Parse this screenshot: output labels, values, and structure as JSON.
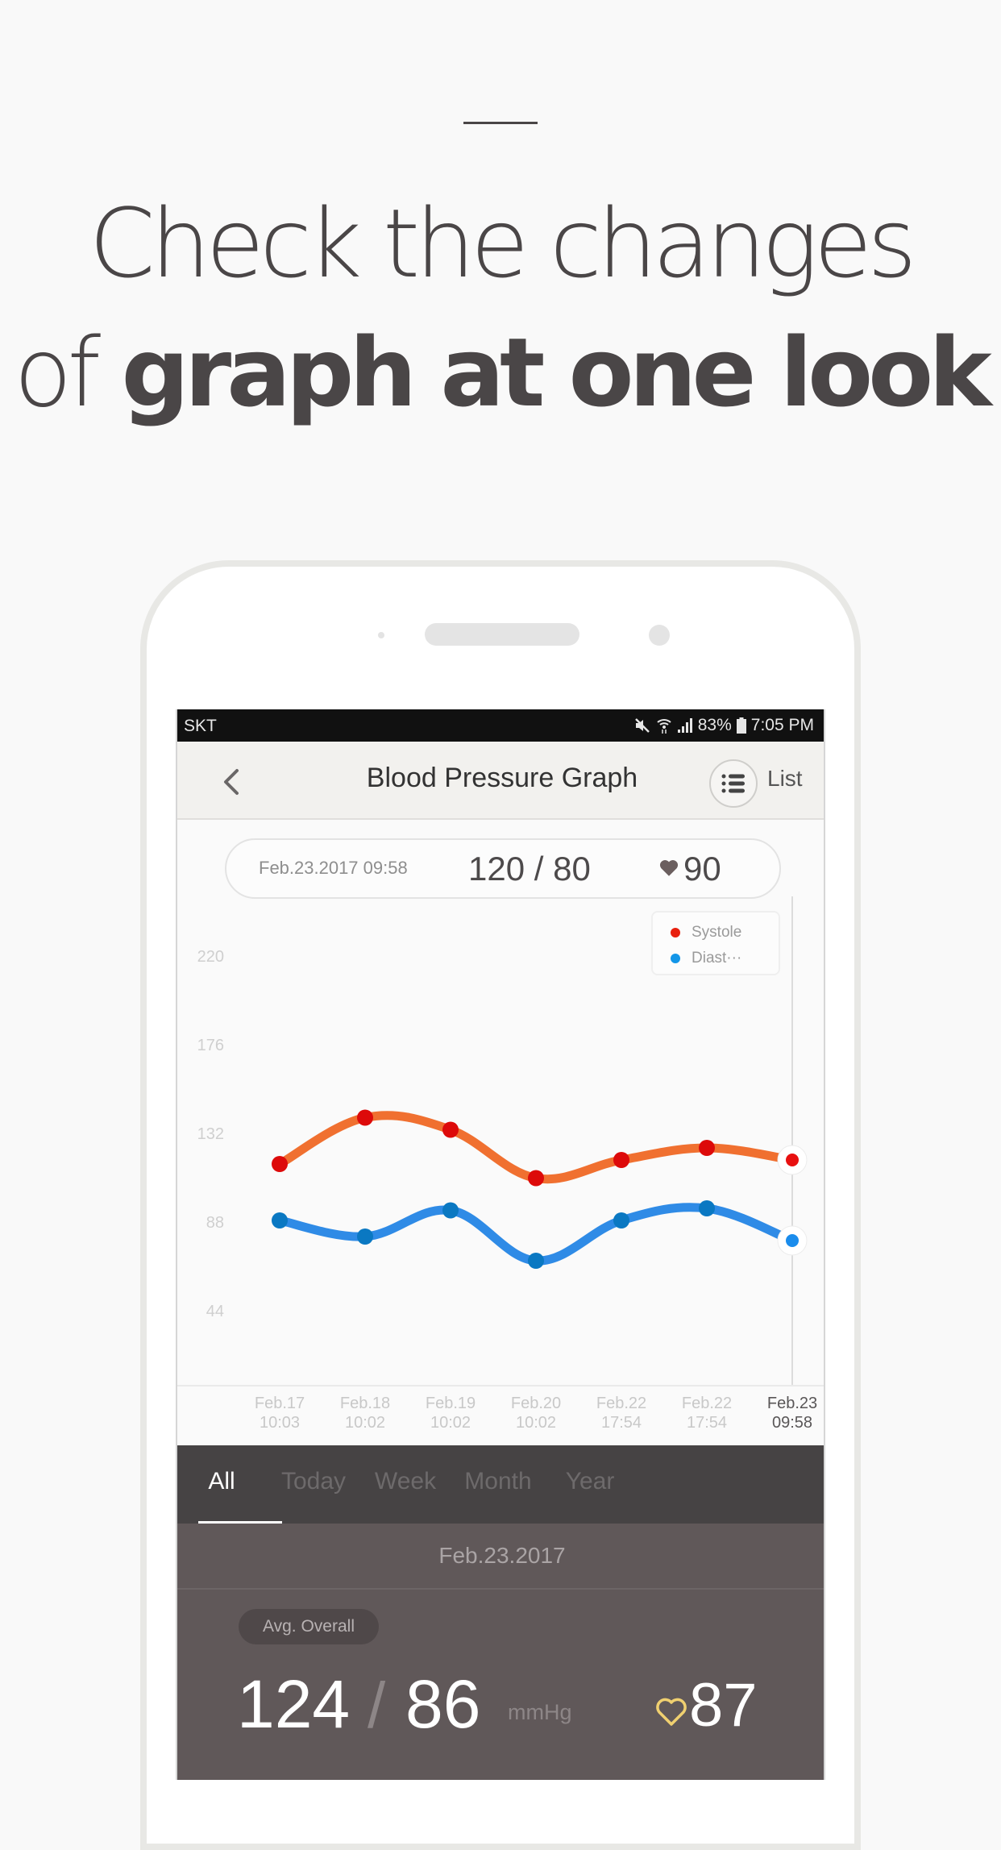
{
  "promo": {
    "headline_line1": "Check the changes",
    "headline_line2_light": "of",
    "headline_line2_bold": "graph at one look"
  },
  "status_bar": {
    "carrier": "SKT",
    "battery": "83%",
    "time": "7:05 PM",
    "icons": [
      "mute-icon",
      "wifi-icon",
      "signal-icon",
      "battery-icon"
    ]
  },
  "app_bar": {
    "title": "Blood Pressure Graph",
    "back_icon": "chevron-left-icon",
    "list_icon": "list-icon",
    "list_label": "List"
  },
  "selected_reading": {
    "datetime": "Feb.23.2017 09:58",
    "bp": "120 / 80",
    "pulse": "90"
  },
  "tabs": [
    {
      "label": "All",
      "active": true
    },
    {
      "label": "Today",
      "active": false
    },
    {
      "label": "Week",
      "active": false
    },
    {
      "label": "Month",
      "active": false
    },
    {
      "label": "Year",
      "active": false
    }
  ],
  "date_row": "Feb.23.2017",
  "summary": {
    "badge": "Avg. Overall",
    "systolic": "124",
    "slash": "/",
    "diastolic": "86",
    "unit": "mmHg",
    "pulse": "87"
  },
  "chart_data": {
    "type": "line",
    "title": "Blood Pressure Graph",
    "xlabel": "",
    "ylabel": "",
    "ylim": [
      0,
      220
    ],
    "yticks": [
      44,
      88,
      132,
      176,
      220
    ],
    "x": [
      {
        "date": "Feb.17",
        "time": "10:03"
      },
      {
        "date": "Feb.18",
        "time": "10:02"
      },
      {
        "date": "Feb.19",
        "time": "10:02"
      },
      {
        "date": "Feb.20",
        "time": "10:02"
      },
      {
        "date": "Feb.22",
        "time": "17:54"
      },
      {
        "date": "Feb.22",
        "time": "17:54"
      },
      {
        "date": "Feb.23",
        "time": "09:58"
      }
    ],
    "selected_index": 6,
    "grid": false,
    "legend_position": "top-right",
    "series": [
      {
        "name": "Systole",
        "legend_label": "Systole",
        "line_color": "#f07030",
        "point_color": "#dd0a0a",
        "values": [
          118,
          141,
          135,
          111,
          120,
          126,
          120
        ]
      },
      {
        "name": "Diastole",
        "legend_label": "Diast···",
        "line_color": "#2f8be6",
        "point_color": "#0a78c2",
        "values": [
          90,
          82,
          95,
          70,
          90,
          96,
          80
        ]
      }
    ]
  }
}
